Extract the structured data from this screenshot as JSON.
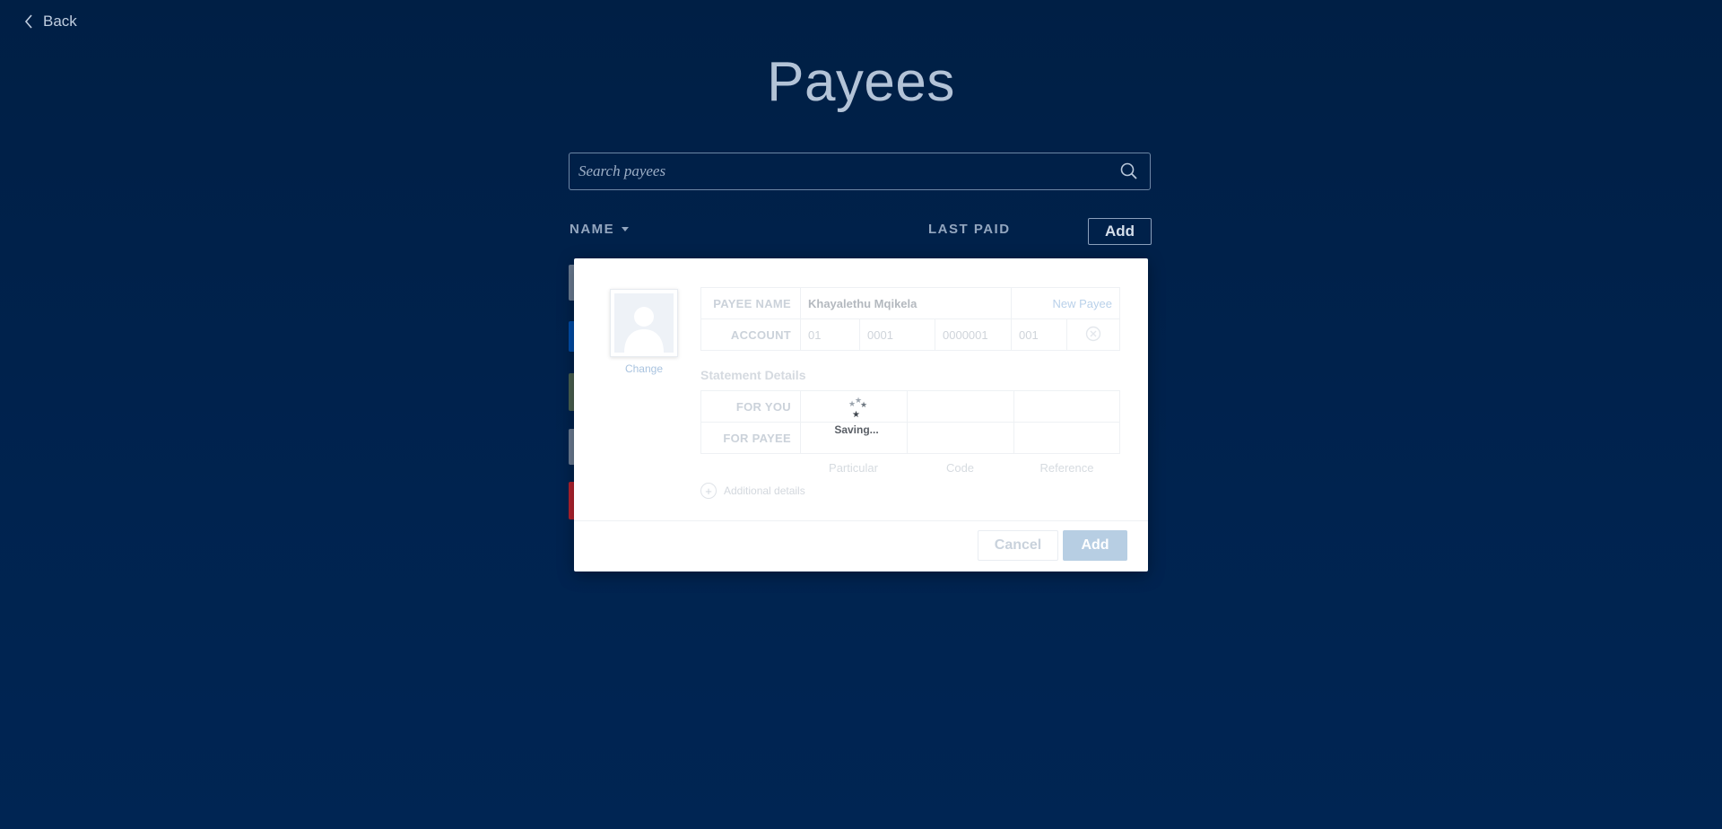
{
  "nav": {
    "back_label": "Back"
  },
  "page": {
    "title": "Payees"
  },
  "search": {
    "placeholder": "Search payees"
  },
  "list": {
    "col_name": "NAME",
    "col_last_paid": "LAST PAID",
    "add_label": "Add",
    "row_stub_colors": [
      "#6b7c92",
      "#004da8",
      "#4a6150",
      "#6b7c92",
      "#b3232f"
    ]
  },
  "modal": {
    "avatar_change": "Change",
    "payee_name_label": "PAYEE NAME",
    "payee_name_value": "Khayalethu Mqikela",
    "new_payee": "New Payee",
    "account_label": "ACCOUNT",
    "account": {
      "bank": "01",
      "branch": "0001",
      "number": "0000001",
      "suffix": "001"
    },
    "statement_title": "Statement Details",
    "for_you_label": "FOR YOU",
    "for_payee_label": "FOR PAYEE",
    "col_particular": "Particular",
    "col_code": "Code",
    "col_reference": "Reference",
    "additional_details": "Additional details",
    "cancel": "Cancel",
    "add": "Add",
    "saving": "Saving..."
  },
  "colors": {
    "background": "#00234f",
    "accent_button": "#b7cee3"
  }
}
